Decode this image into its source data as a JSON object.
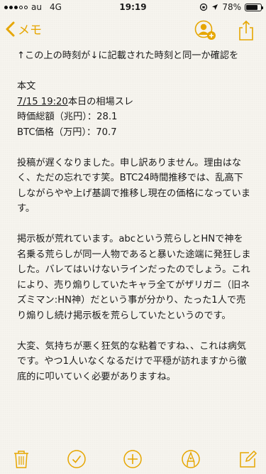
{
  "status_bar": {
    "carrier": "au",
    "network": "4G",
    "time": "19:19",
    "battery_percent": "78%",
    "battery_level": 0.78
  },
  "nav": {
    "back_label": "メモ",
    "accent_color": "#e6a600"
  },
  "note": {
    "line_1": "↑この上の時刻が↓に記載された時刻と同一か確認を",
    "line_2": "本文",
    "line_3_date": "7/15 19:20",
    "line_3_rest": "本日の相場スレ",
    "line_4": "時価総額（兆円）：28.1",
    "line_5": "BTC価格（万円）：70.7",
    "para_1": "投稿が遅くなりました。申し訳ありません。理由はなく、ただの忘れです笑。BTC24時間推移では、乱高下しながらやや上げ基調で推移し現在の価格になっています。",
    "para_2": "掲示板が荒れています。abcという荒らしとHNで神を名乗る荒らしが同一人物であると暴いた途端に発狂しました。バレてはいけないラインだったのでしょう。これにより、売り煽りしていたキャラ全てがザリガニ（旧ネズミマン:HN神）だという事が分かり、たった1人で売り煽りし続け掲示板を荒らしていたというのです。",
    "para_3": "大変、気持ちが悪く狂気的な粘着ですね、、これは病気です。やつ1人いなくなるだけで平穏が訪れますから徹底的に叩いていく必要がありますね。"
  },
  "icons": {
    "add_person": "add-person-icon",
    "share": "share-icon",
    "trash": "trash-icon",
    "checklist": "checkmark-circle-icon",
    "new_item": "plus-circle-icon",
    "markup": "pen-circle-icon",
    "compose": "compose-icon"
  }
}
